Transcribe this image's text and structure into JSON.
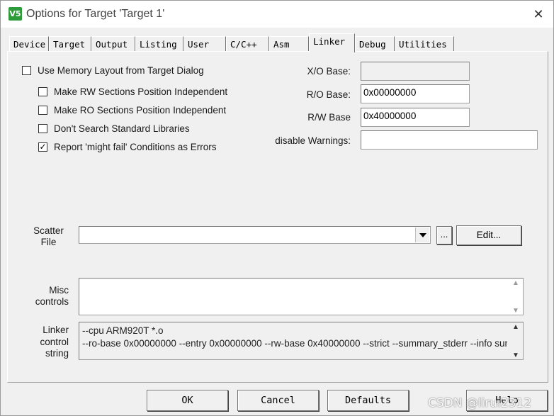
{
  "window": {
    "title": "Options for Target 'Target 1'",
    "app_icon_glyph": "V5",
    "close_glyph": "✕"
  },
  "tabs": [
    {
      "label": "Device"
    },
    {
      "label": "Target"
    },
    {
      "label": "Output"
    },
    {
      "label": "Listing"
    },
    {
      "label": "User"
    },
    {
      "label": "C/C++"
    },
    {
      "label": "Asm"
    },
    {
      "label": "Linker"
    },
    {
      "label": "Debug"
    },
    {
      "label": "Utilities"
    }
  ],
  "active_tab": "Linker",
  "checkboxes": {
    "use_memory_layout": {
      "label": "Use Memory Layout from Target Dialog",
      "checked": false
    },
    "rw_independent": {
      "label": "Make RW Sections Position Independent",
      "checked": false
    },
    "ro_independent": {
      "label": "Make RO Sections Position Independent",
      "checked": false
    },
    "no_std_libs": {
      "label": "Don't Search Standard Libraries",
      "checked": false
    },
    "might_fail_errors": {
      "label": "Report 'might fail' Conditions as Errors",
      "checked": true
    }
  },
  "check_glyph": "✓",
  "bases": {
    "xo_label": "X/O Base:",
    "xo_value": "",
    "ro_label": "R/O Base:",
    "ro_value": "0x00000000",
    "rw_label": "R/W Base",
    "rw_value": "0x40000000"
  },
  "warnings": {
    "label": "disable Warnings:",
    "value": ""
  },
  "scatter": {
    "label_line1": "Scatter",
    "label_line2": "File",
    "value": "",
    "browse_label": "...",
    "edit_label": "Edit..."
  },
  "misc": {
    "label_line1": "Misc",
    "label_line2": "controls",
    "value": ""
  },
  "linker_string": {
    "label_line1": "Linker",
    "label_line2": "control",
    "label_line3": "string",
    "line1": "--cpu ARM920T *.o",
    "line2": "--ro-base 0x00000000 --entry 0x00000000 --rw-base 0x40000000 --strict --summary_stderr --info summa"
  },
  "buttons": {
    "ok": "OK",
    "cancel": "Cancel",
    "defaults": "Defaults",
    "help": "Help"
  },
  "watermark": "CSDN @lirui2312"
}
